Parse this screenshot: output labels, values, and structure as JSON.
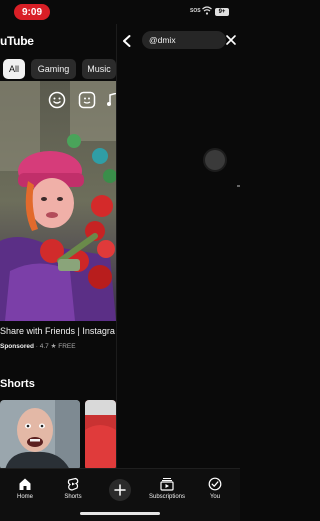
{
  "status_bar": {
    "time": "9:09",
    "signal_text": "SOS",
    "battery": "9+"
  },
  "youtube": {
    "logo_text": "uTube",
    "chips": [
      "All",
      "Gaming",
      "Music"
    ],
    "ad": {
      "title": "Share with Friends | Instagra",
      "sponsored_label": "Sponsored",
      "rating": "4.7 ★",
      "price": "FREE"
    },
    "shorts_heading": "Shorts"
  },
  "search": {
    "query": "@dmix"
  },
  "bottom_nav": {
    "home": "Home",
    "shorts": "Shorts",
    "subscriptions": "Subscriptions",
    "you": "You"
  },
  "colors": {
    "background": "#0a0a0a",
    "status_time_pill": "#d91f26",
    "chip_selected": "#f1f1f1",
    "chip_default": "#2b2b2b"
  }
}
